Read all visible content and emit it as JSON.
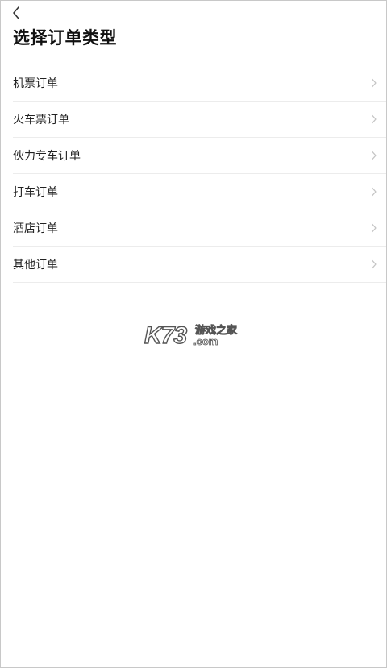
{
  "header": {
    "title": "选择订单类型",
    "back_icon": "chevron-left-icon"
  },
  "order_types": [
    {
      "label": "机票订单",
      "icon": "chevron-right-icon"
    },
    {
      "label": "火车票订单",
      "icon": "chevron-right-icon"
    },
    {
      "label": "伙力专车订单",
      "icon": "chevron-right-icon"
    },
    {
      "label": "打车订单",
      "icon": "chevron-right-icon"
    },
    {
      "label": "酒店订单",
      "icon": "chevron-right-icon"
    },
    {
      "label": "其他订单",
      "icon": "chevron-right-icon"
    }
  ],
  "watermark": {
    "brand": "K73",
    "site_name": "游戏之家",
    "domain": ".com"
  },
  "colors": {
    "title": "#111111",
    "item_text": "#222222",
    "divider": "#ececec",
    "chevron": "#c4c4c4"
  }
}
